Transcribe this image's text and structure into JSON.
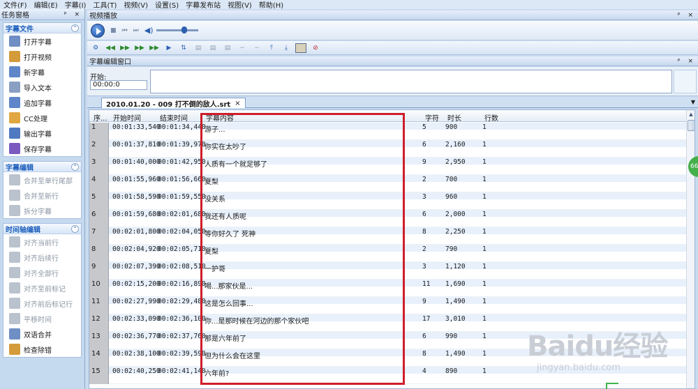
{
  "menu": [
    "文件(F)",
    "编辑(E)",
    "字幕(I)",
    "工具(T)",
    "视频(V)",
    "设置(S)",
    "字幕发布站",
    "视图(V)",
    "帮助(H)"
  ],
  "taskpane": {
    "title": "任务窗格",
    "controls": "ᵖ ×",
    "groups": [
      {
        "title": "字幕文件",
        "items": [
          {
            "label": "打开字幕",
            "icon": "open-subtitle-icon",
            "enabled": true
          },
          {
            "label": "打开视频",
            "icon": "open-video-icon",
            "enabled": true
          },
          {
            "label": "新字幕",
            "icon": "new-subtitle-icon",
            "enabled": true
          },
          {
            "label": "导入文本",
            "icon": "import-text-icon",
            "enabled": true
          },
          {
            "label": "追加字幕",
            "icon": "append-subtitle-icon",
            "enabled": true
          },
          {
            "label": "CC处理",
            "icon": "cc-process-icon",
            "enabled": true
          },
          {
            "label": "输出字幕",
            "icon": "export-subtitle-icon",
            "enabled": true
          },
          {
            "label": "保存字幕",
            "icon": "save-subtitle-icon",
            "enabled": true
          }
        ]
      },
      {
        "title": "字幕编辑",
        "items": [
          {
            "label": "合并至单行尾部",
            "icon": "merge-line-end-icon",
            "enabled": false
          },
          {
            "label": "合并至新行",
            "icon": "merge-new-line-icon",
            "enabled": false
          },
          {
            "label": "拆分字幕",
            "icon": "split-subtitle-icon",
            "enabled": false
          }
        ]
      },
      {
        "title": "时间轴编辑",
        "items": [
          {
            "label": "对齐当前行",
            "icon": "align-current-icon",
            "enabled": false
          },
          {
            "label": "对齐后续行",
            "icon": "align-following-icon",
            "enabled": false
          },
          {
            "label": "对齐全部行",
            "icon": "align-all-icon",
            "enabled": false
          },
          {
            "label": "对齐至前标记",
            "icon": "align-prev-mark-icon",
            "enabled": false
          },
          {
            "label": "对齐前后标记行",
            "icon": "align-marks-icon",
            "enabled": false
          },
          {
            "label": "平移时间",
            "icon": "shift-time-icon",
            "enabled": false
          },
          {
            "label": "双语合并",
            "icon": "bilingual-merge-icon",
            "enabled": true
          },
          {
            "label": "检查除错",
            "icon": "check-errors-icon",
            "enabled": true
          }
        ]
      }
    ]
  },
  "video_panel": {
    "title": "视频播放",
    "volume_level": 0.7
  },
  "edit_panel": {
    "title": "字幕编辑窗口",
    "start_label": "开始:",
    "start_value": "00:00:0"
  },
  "tab": {
    "label": "2010.01.20 - 009 打不倒的敌人.srt",
    "close": "×"
  },
  "grid": {
    "columns": [
      "序...",
      "开始时间",
      "结束时间",
      "字幕内容",
      "字符",
      "时长",
      "行数"
    ],
    "rows": [
      [
        "1",
        "00:01:33,540",
        "00:01:34,440",
        "游子...",
        "5",
        "900",
        "1"
      ],
      [
        "2",
        "00:01:37,810",
        "00:01:39,970",
        "你实在太吵了",
        "6",
        "2,160",
        "1"
      ],
      [
        "3",
        "00:01:40,000",
        "00:01:42,950",
        "人质有一个就足够了",
        "9",
        "2,950",
        "1"
      ],
      [
        "4",
        "00:01:55,960",
        "00:01:56,660",
        "夏梨",
        "2",
        "700",
        "1"
      ],
      [
        "5",
        "00:01:58,590",
        "00:01:59,550",
        "没关系",
        "3",
        "960",
        "1"
      ],
      [
        "6",
        "00:01:59,680",
        "00:02:01,680",
        "我还有人质呢",
        "6",
        "2,000",
        "1"
      ],
      [
        "7",
        "00:02:01,800",
        "00:02:04,050",
        "等你好久了 死神",
        "8",
        "2,250",
        "1"
      ],
      [
        "8",
        "00:02:04,920",
        "00:02:05,710",
        "夏梨",
        "2",
        "790",
        "1"
      ],
      [
        "9",
        "00:02:07,390",
        "00:02:08,510",
        "一护哥",
        "3",
        "1,120",
        "1"
      ],
      [
        "10",
        "00:02:15,200",
        "00:02:16,890",
        "喝...那家伙是...",
        "11",
        "1,690",
        "1"
      ],
      [
        "11",
        "00:02:27,990",
        "00:02:29,480",
        "这是怎么回事...",
        "9",
        "1,490",
        "1"
      ],
      [
        "12",
        "00:02:33,090",
        "00:02:36,100",
        "你...是那时候在河边的那个家伙吧",
        "17",
        "3,010",
        "1"
      ],
      [
        "13",
        "00:02:36,770",
        "00:02:37,760",
        "那是六年前了",
        "6",
        "990",
        "1"
      ],
      [
        "14",
        "00:02:38,100",
        "00:02:39,590",
        "但为什么会在这里",
        "8",
        "1,490",
        "1"
      ],
      [
        "15",
        "00:02:40,250",
        "00:02:41,140",
        "六年前?",
        "4",
        "890",
        "1"
      ]
    ]
  },
  "badge": "66",
  "watermark": {
    "main": "Baidu经验",
    "sub": "jingyan.baidu.com"
  },
  "colors": {
    "highlight": "#cf1d2a",
    "group_title": "#1b5dbb"
  }
}
